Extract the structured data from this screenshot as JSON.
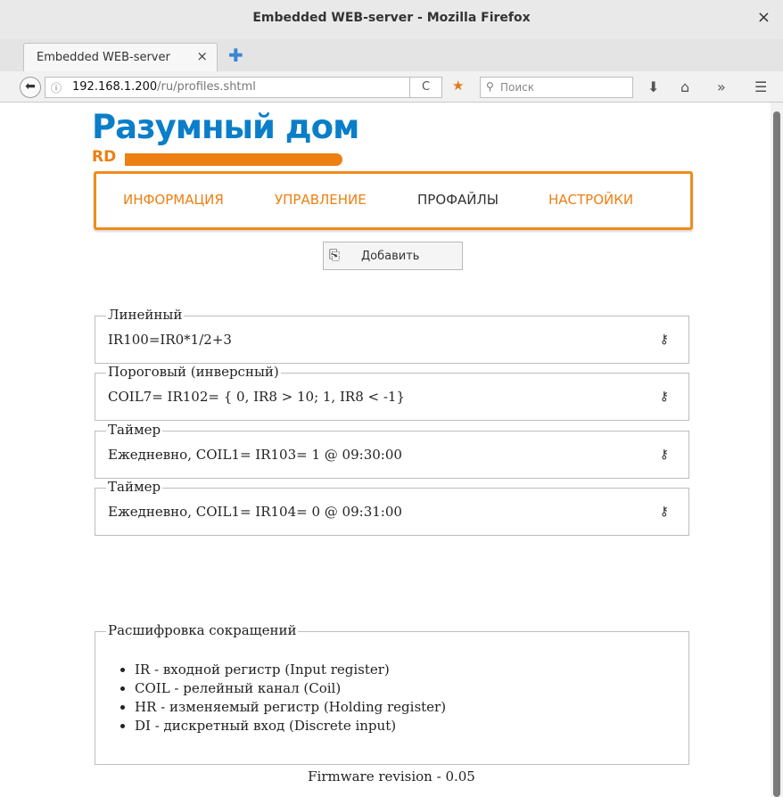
{
  "window": {
    "title": "Embedded WEB-server - Mozilla Firefox",
    "close_glyph": "×"
  },
  "tabs": [
    {
      "label": "Embedded WEB-server",
      "close_glyph": "×"
    }
  ],
  "newtab_glyph": "✚",
  "nav": {
    "back_glyph": "⬅",
    "info_glyph": "ⓘ",
    "url_host": "192.168.1.200",
    "url_path": "/ru/profiles.shtml",
    "reload_glyph": "C",
    "search_icon_glyph": "⚲",
    "search_placeholder": "Поиск",
    "download_glyph": "⬇",
    "home_glyph": "⌂",
    "more_glyph": "»",
    "menu_glyph": "☰"
  },
  "logo": {
    "title": "Разумный дом",
    "subtitle": "RD"
  },
  "menu": [
    {
      "label": "ИНФОРМАЦИЯ",
      "active": false
    },
    {
      "label": "УПРАВЛЕНИЕ",
      "active": false
    },
    {
      "label": "ПРОФАЙЛЫ",
      "active": true
    },
    {
      "label": "НАСТРОЙКИ",
      "active": false
    }
  ],
  "add_button": {
    "label": "Добавить",
    "icon_glyph": "⎘"
  },
  "profiles": [
    {
      "name": "Линейный",
      "expression": "IR100=IR0*1/2+3",
      "key_glyph": "⚷"
    },
    {
      "name": "Пороговый (инверсный)",
      "expression": "COIL7= IR102= { 0, IR8 > 10; 1, IR8 < -1}",
      "key_glyph": "⚷"
    },
    {
      "name": "Таймер",
      "expression": "Ежедневно, COIL1= IR103= 1 @ 09:30:00",
      "key_glyph": "⚷"
    },
    {
      "name": "Таймер",
      "expression": "Ежедневно, COIL1= IR104= 0 @ 09:31:00",
      "key_glyph": "⚷"
    }
  ],
  "abbreviations": {
    "title": "Расшифровка сокращений",
    "items": [
      "IR - входной регистр (Input register)",
      "COIL - релейный канал (Coil)",
      "HR - изменяемый регистр (Holding register)",
      "DI - дискретный вход (Discrete input)"
    ]
  },
  "footer": {
    "firmware": "Firmware revision - 0.05"
  },
  "colors": {
    "brand_blue": "#0a7ec9",
    "brand_orange": "#ee7f12"
  }
}
